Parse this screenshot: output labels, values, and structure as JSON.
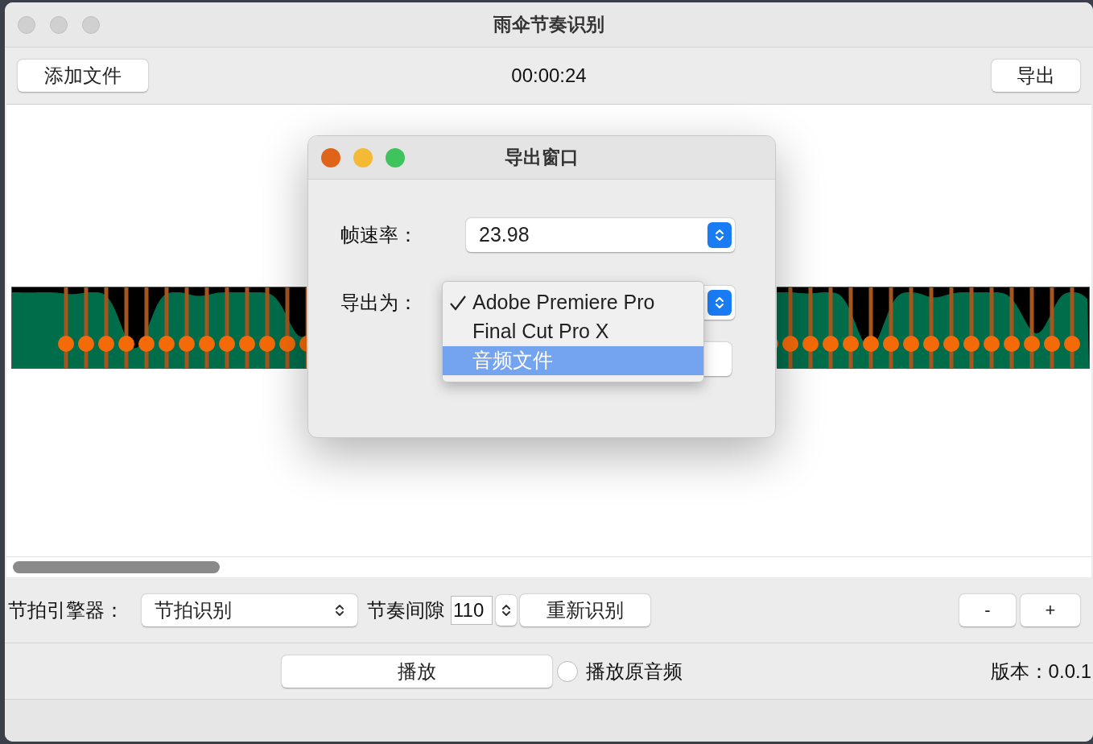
{
  "window": {
    "title": "雨伞节奏识别"
  },
  "toolbar": {
    "add_file_button": "添加文件",
    "time": "00:00:24",
    "export_button": "导出"
  },
  "controls": {
    "engine_label": "节拍引擎器：",
    "engine_select": "节拍识别",
    "interval_label": "节奏间隙",
    "interval_value": "110",
    "redetect_button": "重新识别",
    "zoom_out_button": "-",
    "zoom_in_button": "+"
  },
  "playback": {
    "play_button": "播放",
    "play_original": {
      "label": "播放原音频",
      "checked": false
    },
    "version": "版本：0.0.1"
  },
  "dialog": {
    "title": "导出窗口",
    "frame_rate_label": "帧速率：",
    "frame_rate_value": "23.98",
    "export_as_label": "导出为：",
    "export_as_menu": [
      {
        "label": "Adobe Premiere Pro",
        "selected": true,
        "highlighted": false
      },
      {
        "label": "Final Cut Pro X",
        "selected": false,
        "highlighted": false
      },
      {
        "label": "音频文件",
        "selected": false,
        "highlighted": true
      }
    ]
  }
}
